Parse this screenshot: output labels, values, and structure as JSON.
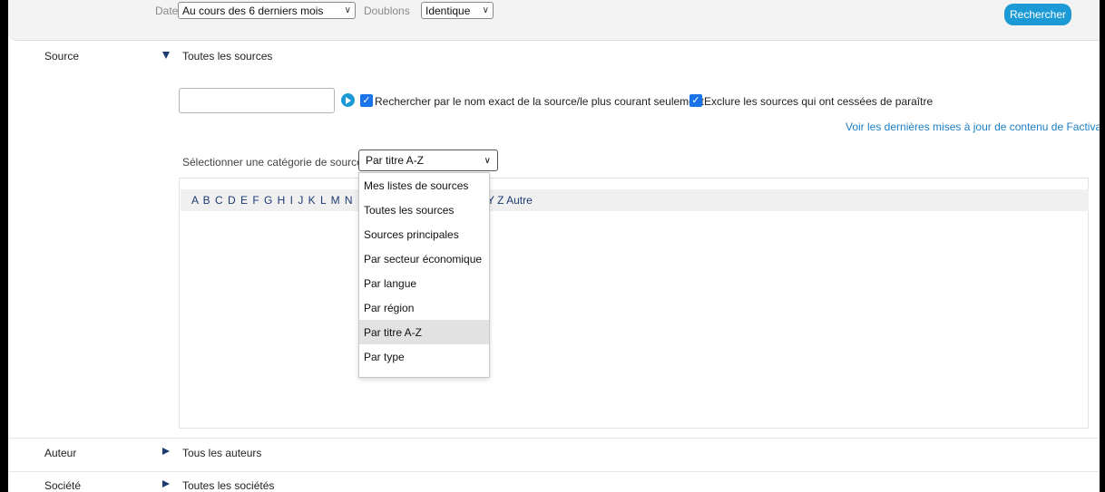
{
  "topbar": {
    "date_label": "Date",
    "date_value": "Au cours des 6 derniers mois",
    "doublons_label": "Doublons",
    "doublons_value": "Identique",
    "search_button": "Rechercher"
  },
  "source": {
    "label": "Source",
    "value": "Toutes les sources",
    "input_value": "",
    "checkbox_exact_label": "Rechercher par le nom exact de la source/le plus courant seulement",
    "checkbox_exact_checked": true,
    "checkbox_exclude_label": "Exclure les sources qui ont cessées de paraître",
    "checkbox_exclude_checked": true,
    "updates_link": "Voir les dernières mises à jour de contenu de Factiva",
    "category_label": "Sélectionner une catégorie de sources",
    "category_selected": "Par titre A-Z",
    "alphabet_visible": "A B C D E F G H I J K L M N",
    "alphabet_tail": "Y Z Autre",
    "category_options": [
      "Mes listes de sources",
      "Toutes les sources",
      "Sources principales",
      "Par secteur économique",
      "Par langue",
      "Par région",
      "Par titre A-Z",
      "Par type"
    ]
  },
  "auteur": {
    "label": "Auteur",
    "value": "Tous les auteurs"
  },
  "societe": {
    "label": "Société",
    "value": "Toutes les sociétés"
  },
  "colors": {
    "accent": "#1c9ad6",
    "link": "#1c7fc4",
    "triangle": "#1d3a73",
    "checkbox": "#1a73e8"
  }
}
